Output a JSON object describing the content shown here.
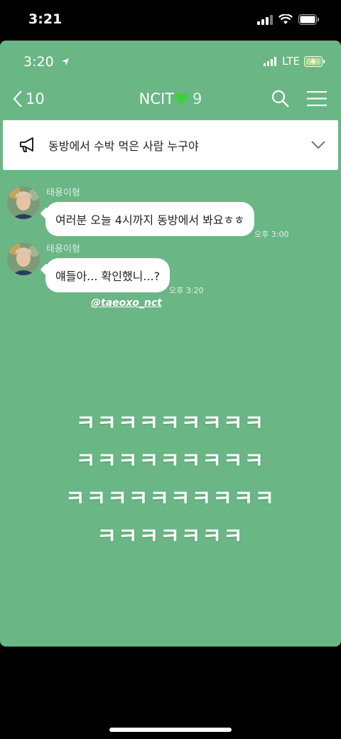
{
  "outer_status": {
    "time": "3:21"
  },
  "inner_status": {
    "time": "3:20",
    "network": "LTE"
  },
  "nav": {
    "back_count": "10",
    "title": "NCIT",
    "member_count": "9"
  },
  "notice": {
    "text": "동방에서 수박 먹은 사람 누구야"
  },
  "messages": [
    {
      "sender": "태용이형",
      "text": "여러분 오늘 4시까지 동방에서 봐요ㅎㅎ",
      "time": "오후 3:00"
    },
    {
      "sender": "태용이형",
      "text": "얘들아... 확인했니...?",
      "time": "오후 3:20"
    }
  ],
  "tag": "@taeoxo_nct",
  "laughs": [
    "ㅋㅋㅋㅋㅋㅋㅋㅋㅋ",
    "ㅋㅋㅋㅋㅋㅋㅋㅋㅋ",
    "ㅋㅋㅋㅋㅋㅋㅋㅋㅋㅋ",
    "ㅋㅋㅋㅋㅋㅋㅋ"
  ],
  "colors": {
    "chat_background": "#6ab685",
    "bubble": "#ffffff",
    "heart": "#3cd13c"
  },
  "icons": [
    "signal-icon",
    "wifi-icon",
    "battery-icon",
    "location-arrow-icon",
    "charging-battery-icon",
    "back-chevron-icon",
    "green-heart-icon",
    "search-icon",
    "menu-icon",
    "megaphone-icon",
    "chevron-down-icon"
  ]
}
